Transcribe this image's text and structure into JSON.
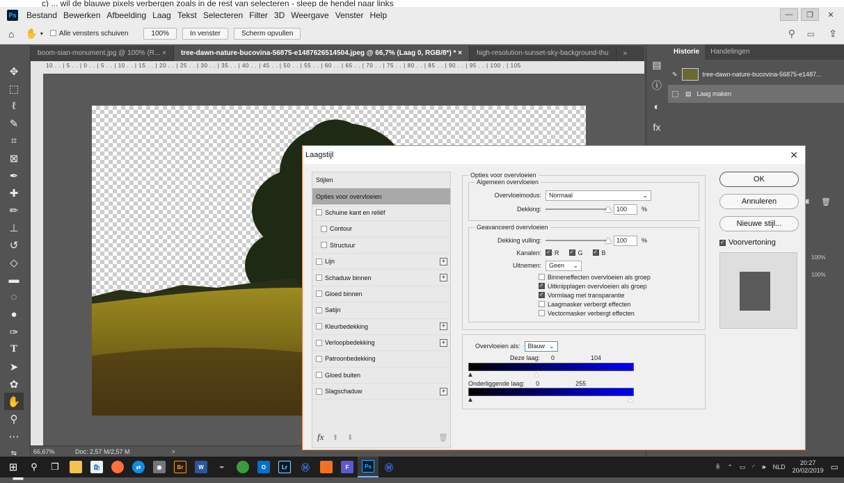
{
  "caption": "c) ... wil de blauwe pixels verbergen zoals in de rest van selecteren - sleep de hendel naar links",
  "menu": [
    "Bestand",
    "Bewerken",
    "Afbeelding",
    "Laag",
    "Tekst",
    "Selecteren",
    "Filter",
    "3D",
    "Weergave",
    "Venster",
    "Help"
  ],
  "ps_logo": "Ps",
  "options": {
    "scroll_all": "Alle vensters schuiven",
    "zoom100": "100%",
    "fit": "In venster",
    "fill": "Scherm opvullen"
  },
  "tabs": [
    "boom-sian-monument.jpg @ 100% (R... ×",
    "tree-dawn-nature-bucovina-56875-e1487626514504.jpeg @ 66,7% (Laag 0, RGB/8*) * ×",
    "high-resolution-sunset-sky-background-thu"
  ],
  "tabs_more": "»",
  "ruler_h": "10 . . | 5 . . | 0 . . | 5 . . | 10 . . | 15 . . | 20 . . | 25 . . | 30 . . | 35 . . | 40 . . | 45 . . | 50 . . | 55 . . | 60 . . | 65 . . | 70 . . | 75 . . | 80 . . | 85 . . | 90 . . | 95 . . | 100 . | 105",
  "status": {
    "zoom": "66,67%",
    "doc": "Doc: 2,57 M/2,57 M",
    "arrow": ">"
  },
  "history": {
    "tab_history": "Historie",
    "tab_actions": "Handelingen",
    "snapshot": "tree-dawn-nature-bucovina-56875-e1487...",
    "step": "Laag maken"
  },
  "dialog": {
    "title": "Laagstijl",
    "styles_header": "Stijlen",
    "styles": [
      {
        "label": "Opties voor overvloeien",
        "selected": true,
        "checkbox": false,
        "indent": false,
        "plus": false
      },
      {
        "label": "Schuine kant en reliëf",
        "checkbox": true,
        "indent": false,
        "plus": false
      },
      {
        "label": "Contour",
        "checkbox": true,
        "indent": true,
        "plus": false
      },
      {
        "label": "Structuur",
        "checkbox": true,
        "indent": true,
        "plus": false
      },
      {
        "label": "Lijn",
        "checkbox": true,
        "indent": false,
        "plus": true
      },
      {
        "label": "Schaduw binnen",
        "checkbox": true,
        "indent": false,
        "plus": true
      },
      {
        "label": "Gloed binnen",
        "checkbox": true,
        "indent": false,
        "plus": false
      },
      {
        "label": "Satijn",
        "checkbox": true,
        "indent": false,
        "plus": false
      },
      {
        "label": "Kleurbedekking",
        "checkbox": true,
        "indent": false,
        "plus": true
      },
      {
        "label": "Verloopbedekking",
        "checkbox": true,
        "indent": false,
        "plus": true
      },
      {
        "label": "Patroonbedekking",
        "checkbox": true,
        "indent": false,
        "plus": false
      },
      {
        "label": "Gloed buiten",
        "checkbox": true,
        "indent": false,
        "plus": false
      },
      {
        "label": "Slagschaduw",
        "checkbox": true,
        "indent": false,
        "plus": true
      }
    ],
    "fx": "fx",
    "blend": {
      "section": "Opties voor overvloeien",
      "general": "Algemeen overvloeien",
      "mode_label": "Overvloeimodus:",
      "mode_value": "Normaal",
      "opacity_label": "Dekking:",
      "opacity_value": "100",
      "pct": "%",
      "advanced": "Geavanceerd overvloeien",
      "fill_label": "Dekking vulling:",
      "fill_value": "100",
      "channels_label": "Kanalen:",
      "channels": [
        "R",
        "G",
        "B"
      ],
      "knockout_label": "Uitnemen:",
      "knockout_value": "Geen",
      "checks": [
        {
          "label": "Binneneffecten overvloeien als groep",
          "checked": false
        },
        {
          "label": "Uitknipplagen overvloeien als groep",
          "checked": true
        },
        {
          "label": "Vormlaag met transparantie",
          "checked": true
        },
        {
          "label": "Laagmasker verbergt effecten",
          "checked": false
        },
        {
          "label": "Vectormasker verbergt effecten",
          "checked": false
        }
      ],
      "blendif_label": "Overvloeien als:",
      "blendif_value": "Blauw",
      "this_layer_label": "Deze laag:",
      "this_layer_low": "0",
      "this_layer_high": "104",
      "under_label": "Onderliggende laag:",
      "under_low": "0",
      "under_high": "255"
    },
    "buttons": {
      "ok": "OK",
      "cancel": "Annuleren",
      "new_style": "Nieuwe stijl...",
      "preview": "Voorvertoning"
    }
  },
  "right_panel_values": [
    "100%",
    "100%"
  ],
  "taskbar": {
    "lang": "NLD",
    "time": "20:27",
    "date": "20/02/2019"
  },
  "colors": {
    "accent_blue": "#0000ff",
    "dialog_border": "#e07a3a"
  }
}
